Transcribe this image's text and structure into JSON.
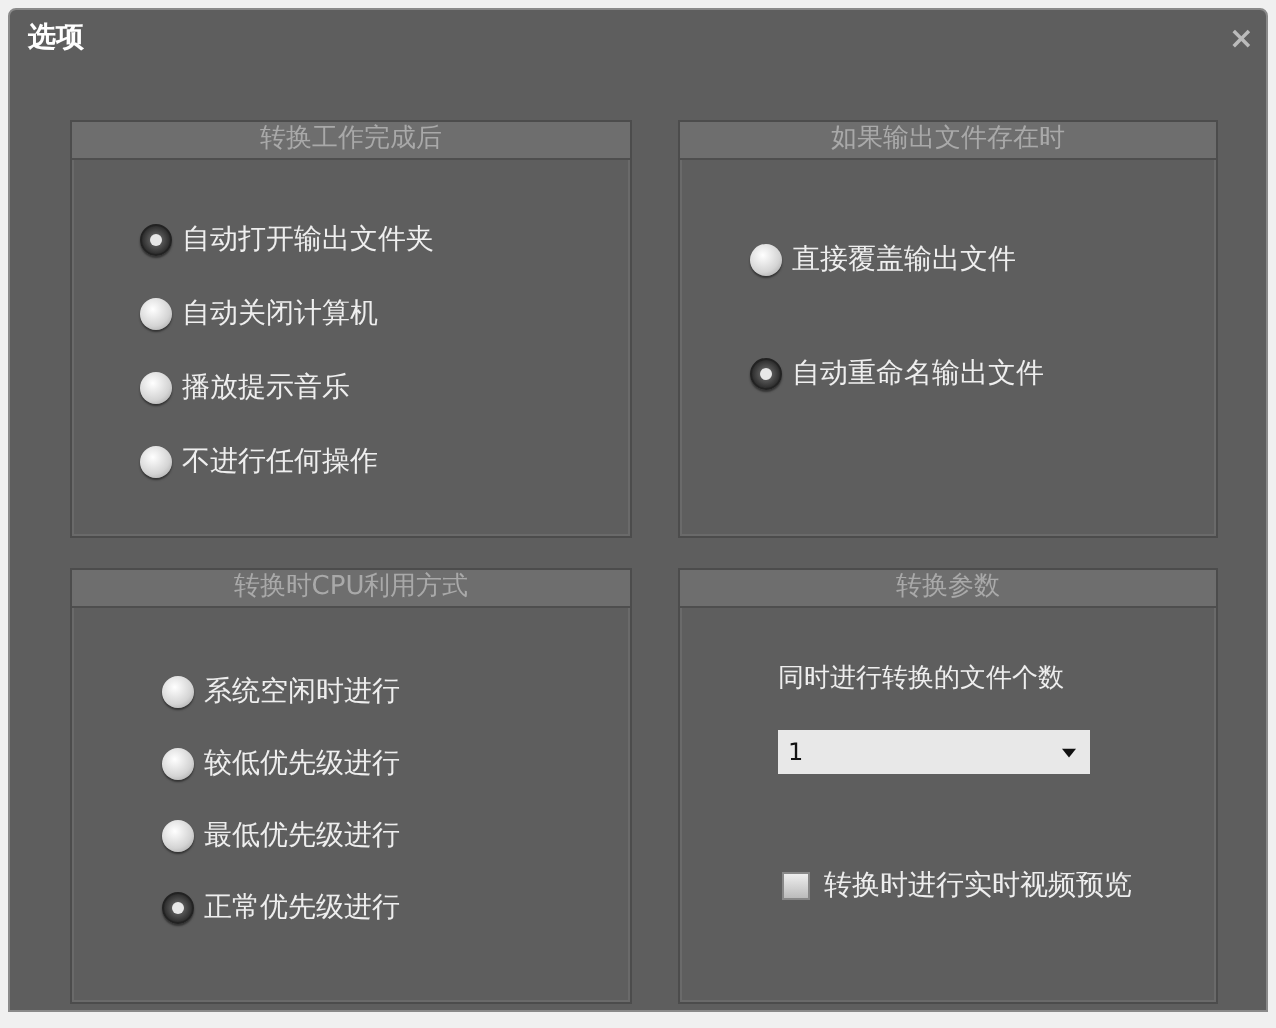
{
  "window": {
    "title": "选项",
    "close": "×"
  },
  "panels": [
    {
      "title": "转换工作完成后",
      "kind": "radios",
      "options": [
        {
          "label": "自动打开输出文件夹",
          "selected": true
        },
        {
          "label": "自动关闭计算机",
          "selected": false
        },
        {
          "label": "播放提示音乐",
          "selected": false
        },
        {
          "label": "不进行任何操作",
          "selected": false
        }
      ]
    },
    {
      "title": "如果输出文件存在时",
      "kind": "radios",
      "options": [
        {
          "label": "直接覆盖输出文件",
          "selected": false
        },
        {
          "label": "自动重命名输出文件",
          "selected": true
        }
      ]
    },
    {
      "title": "转换时CPU利用方式",
      "kind": "radios",
      "options": [
        {
          "label": "系统空闲时进行",
          "selected": false
        },
        {
          "label": "较低优先级进行",
          "selected": false
        },
        {
          "label": "最低优先级进行",
          "selected": false
        },
        {
          "label": "正常优先级进行",
          "selected": true
        }
      ]
    },
    {
      "title": "转换参数",
      "kind": "params",
      "label": "同时进行转换的文件个数",
      "select": {
        "value": "1"
      },
      "checkbox": {
        "label": "转换时进行实时视频预览",
        "checked": false
      }
    }
  ]
}
